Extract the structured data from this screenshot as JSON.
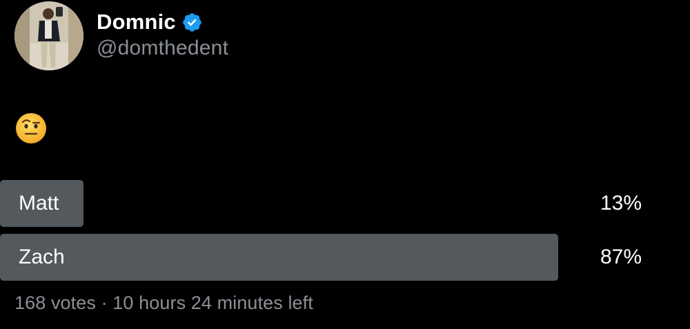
{
  "author": {
    "display_name": "Domnic",
    "handle": "@domthedent",
    "verified": true,
    "avatar_icon": "person-photo-icon",
    "verified_icon": "verified-badge-icon",
    "verified_color": "#1d9bf0"
  },
  "tweet": {
    "emoji_icon": "face-with-raised-eyebrow-emoji"
  },
  "poll": {
    "options": [
      {
        "label": "Matt",
        "percent": "13%",
        "fraction": 0.13
      },
      {
        "label": "Zach",
        "percent": "87%",
        "fraction": 0.87
      }
    ],
    "votes": "168 votes",
    "separator": "·",
    "time_left": "10 hours 24 minutes left",
    "bar_color": "#53595d"
  }
}
